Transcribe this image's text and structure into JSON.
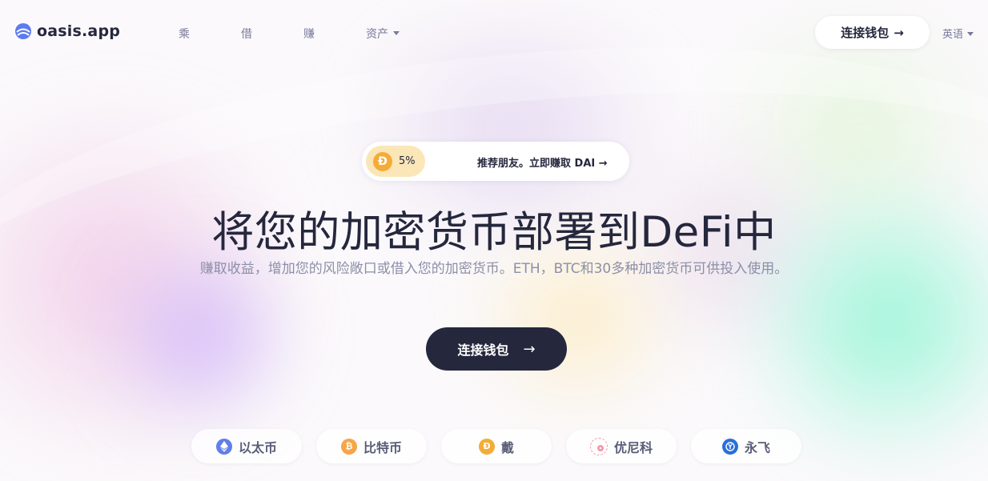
{
  "brand": {
    "name": "oasis.app"
  },
  "nav": {
    "items": [
      {
        "label": "乘"
      },
      {
        "label": "借"
      },
      {
        "label": "赚"
      },
      {
        "label": "资产"
      }
    ]
  },
  "header": {
    "connect_label": "连接钱包",
    "language_label": "英语"
  },
  "referral": {
    "percent": "5%",
    "text": "推荐朋友。立即赚取 DAI →"
  },
  "hero": {
    "title": "将您的加密货币部署到DeFi中",
    "subtitle": "赚取收益，增加您的风险敞口或借入您的加密货币。ETH，BTC和30多种加密货币可供投入使用。",
    "connect_label": "连接钱包"
  },
  "assets": [
    {
      "label": "以太币",
      "icon": "eth-icon",
      "color": "#627eea"
    },
    {
      "label": "比特币",
      "icon": "btc-icon",
      "color": "#f7a54a"
    },
    {
      "label": "戴",
      "icon": "dai-icon",
      "color": "#f5ac37"
    },
    {
      "label": "优尼科",
      "icon": "uniswap-icon",
      "color": "#f29aa6"
    },
    {
      "label": "永飞",
      "icon": "yfi-icon",
      "color": "#2a6fdb"
    }
  ],
  "colors": {
    "primary": "#25273d",
    "muted": "#787a9b",
    "accent_dai": "#f5ac37"
  }
}
